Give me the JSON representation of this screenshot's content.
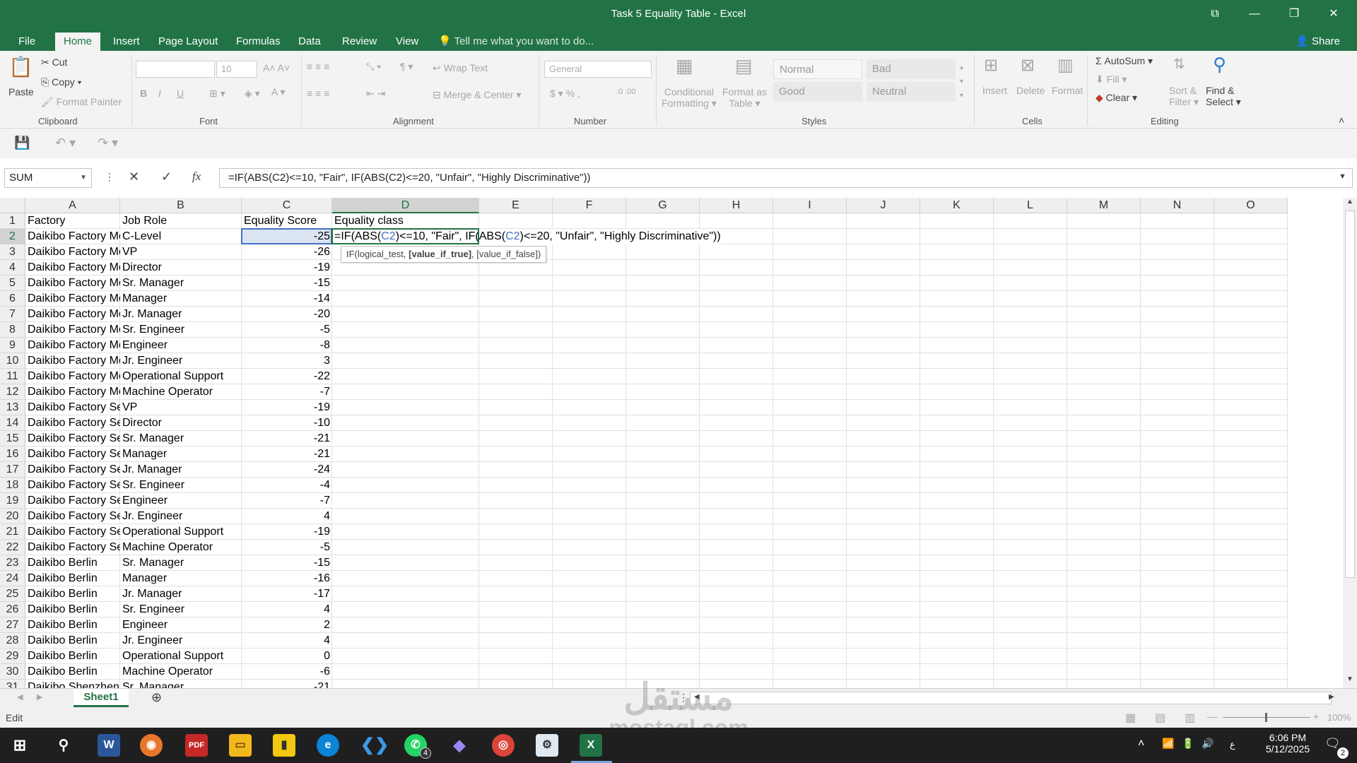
{
  "window": {
    "title": "Task 5 Equality Table - Excel"
  },
  "tabs": [
    "File",
    "Home",
    "Insert",
    "Page Layout",
    "Formulas",
    "Data",
    "Review",
    "View"
  ],
  "active_tab": "Home",
  "tellme": "Tell me what you want to do...",
  "share": "Share",
  "ribbon": {
    "clipboard": {
      "paste": "Paste",
      "cut": "Cut",
      "copy": "Copy",
      "format_painter": "Format Painter",
      "label": "Clipboard"
    },
    "font": {
      "size": "10",
      "label": "Font"
    },
    "alignment": {
      "wrap": "Wrap Text",
      "merge": "Merge & Center",
      "label": "Alignment"
    },
    "number": {
      "format": "General",
      "label": "Number"
    },
    "styles": {
      "conditional1": "Conditional",
      "conditional2": "Formatting",
      "format_as1": "Format as",
      "format_as2": "Table",
      "normal": "Normal",
      "bad": "Bad",
      "good": "Good",
      "neutral": "Neutral",
      "label": "Styles"
    },
    "cells": {
      "insert": "Insert",
      "delete": "Delete",
      "format": "Format",
      "label": "Cells"
    },
    "editing": {
      "autosum": "AutoSum",
      "fill": "Fill",
      "clear": "Clear",
      "sort1": "Sort &",
      "sort2": "Filter",
      "find1": "Find &",
      "find2": "Select",
      "label": "Editing"
    }
  },
  "formula_bar": {
    "name_box": "SUM",
    "formula": "=IF(ABS(C2)<=10, \"Fair\", IF(ABS(C2)<=20, \"Unfair\", \"Highly Discriminative\"))"
  },
  "columns": [
    "A",
    "B",
    "C",
    "D",
    "E",
    "F",
    "G",
    "H",
    "I",
    "J",
    "K",
    "L",
    "M",
    "N",
    "O"
  ],
  "headers": {
    "a": "Factory",
    "b": "Job Role",
    "c": "Equality Score",
    "d": "Equality class"
  },
  "rows": [
    {
      "n": "2",
      "a": "Daikibo Factory Meiyo",
      "b": "C-Level",
      "c": "-25"
    },
    {
      "n": "3",
      "a": "Daikibo Factory Meiyo",
      "b": "VP",
      "c": "-26"
    },
    {
      "n": "4",
      "a": "Daikibo Factory Meiyo",
      "b": "Director",
      "c": "-19"
    },
    {
      "n": "5",
      "a": "Daikibo Factory Meiyo",
      "b": "Sr. Manager",
      "c": "-15"
    },
    {
      "n": "6",
      "a": "Daikibo Factory Meiyo",
      "b": "Manager",
      "c": "-14"
    },
    {
      "n": "7",
      "a": "Daikibo Factory Meiyo",
      "b": "Jr. Manager",
      "c": "-20"
    },
    {
      "n": "8",
      "a": "Daikibo Factory Meiyo",
      "b": "Sr. Engineer",
      "c": "-5"
    },
    {
      "n": "9",
      "a": "Daikibo Factory Meiyo",
      "b": "Engineer",
      "c": "-8"
    },
    {
      "n": "10",
      "a": "Daikibo Factory Meiyo",
      "b": "Jr. Engineer",
      "c": "3"
    },
    {
      "n": "11",
      "a": "Daikibo Factory Meiyo",
      "b": "Operational Support",
      "c": "-22"
    },
    {
      "n": "12",
      "a": "Daikibo Factory Meiyo",
      "b": "Machine Operator",
      "c": "-7"
    },
    {
      "n": "13",
      "a": "Daikibo Factory Seiko",
      "b": "VP",
      "c": "-19"
    },
    {
      "n": "14",
      "a": "Daikibo Factory Seiko",
      "b": "Director",
      "c": "-10"
    },
    {
      "n": "15",
      "a": "Daikibo Factory Seiko",
      "b": "Sr. Manager",
      "c": "-21"
    },
    {
      "n": "16",
      "a": "Daikibo Factory Seiko",
      "b": "Manager",
      "c": "-21"
    },
    {
      "n": "17",
      "a": "Daikibo Factory Seiko",
      "b": "Jr. Manager",
      "c": "-24"
    },
    {
      "n": "18",
      "a": "Daikibo Factory Seiko",
      "b": "Sr. Engineer",
      "c": "-4"
    },
    {
      "n": "19",
      "a": "Daikibo Factory Seiko",
      "b": "Engineer",
      "c": "-7"
    },
    {
      "n": "20",
      "a": "Daikibo Factory Seiko",
      "b": "Jr. Engineer",
      "c": "4"
    },
    {
      "n": "21",
      "a": "Daikibo Factory Seiko",
      "b": "Operational Support",
      "c": "-19"
    },
    {
      "n": "22",
      "a": "Daikibo Factory Seiko",
      "b": "Machine Operator",
      "c": "-5"
    },
    {
      "n": "23",
      "a": "Daikibo Berlin",
      "b": "Sr. Manager",
      "c": "-15"
    },
    {
      "n": "24",
      "a": "Daikibo Berlin",
      "b": "Manager",
      "c": "-16"
    },
    {
      "n": "25",
      "a": "Daikibo Berlin",
      "b": "Jr. Manager",
      "c": "-17"
    },
    {
      "n": "26",
      "a": "Daikibo Berlin",
      "b": "Sr. Engineer",
      "c": "4"
    },
    {
      "n": "27",
      "a": "Daikibo Berlin",
      "b": "Engineer",
      "c": "2"
    },
    {
      "n": "28",
      "a": "Daikibo Berlin",
      "b": "Jr. Engineer",
      "c": "4"
    },
    {
      "n": "29",
      "a": "Daikibo Berlin",
      "b": "Operational Support",
      "c": "0"
    },
    {
      "n": "30",
      "a": "Daikibo Berlin",
      "b": "Machine Operator",
      "c": "-6"
    },
    {
      "n": "31",
      "a": "Daikibo Shenzhen",
      "b": "Sr. Manager",
      "c": "-21"
    }
  ],
  "editing_formula": {
    "p1": "=IF(ABS(",
    "r1": "C2",
    "p2": ")<=10, \"Fair\", IF(ABS(",
    "r2": "C2",
    "p3": ")<=20, \"Unfair\", \"Highly Discriminative\"))"
  },
  "tooltip": {
    "pre": "IF(logical_test, ",
    "bold": "[value_if_true]",
    "post": ", [value_if_false])"
  },
  "sheet": {
    "name": "Sheet1"
  },
  "status": {
    "mode": "Edit",
    "zoom": "100%"
  },
  "taskbar": {
    "time": "6:06 PM",
    "date": "5/12/2025",
    "whatsapp_badge": "4",
    "notif_badge": "2"
  },
  "watermark": {
    "ar": "مستقل",
    "en": "mostaql.com"
  }
}
